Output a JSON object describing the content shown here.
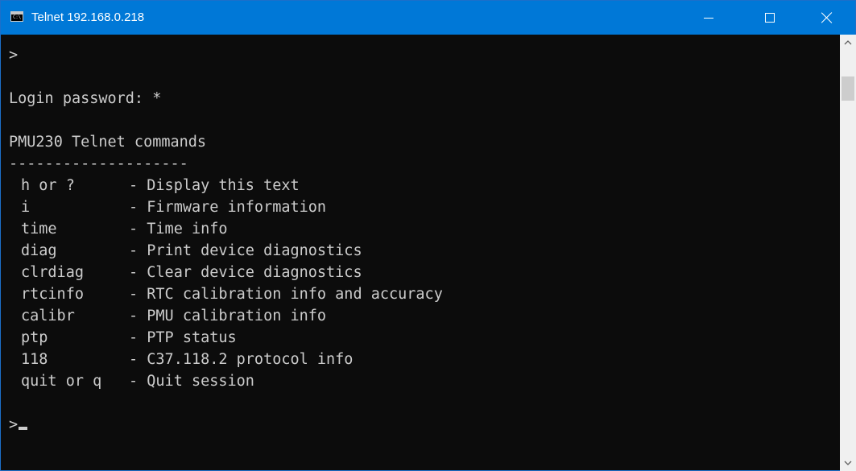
{
  "window": {
    "title": "Telnet 192.168.0.218",
    "icon_label": "C:\\",
    "icon": "console-icon"
  },
  "console": {
    "lines": [
      ">",
      "",
      "Login password: *",
      "",
      "PMU230 Telnet commands",
      "--------------------"
    ],
    "commands": [
      {
        "key": "h or ?",
        "desc": "- Display this text"
      },
      {
        "key": "i",
        "desc": "- Firmware information"
      },
      {
        "key": "time",
        "desc": "- Time info"
      },
      {
        "key": "diag",
        "desc": "- Print device diagnostics"
      },
      {
        "key": "clrdiag",
        "desc": "- Clear device diagnostics"
      },
      {
        "key": "rtcinfo",
        "desc": "- RTC calibration info and accuracy"
      },
      {
        "key": "calibr",
        "desc": "- PMU calibration info"
      },
      {
        "key": "ptp",
        "desc": "- PTP status"
      },
      {
        "key": "118",
        "desc": "- C37.118.2 protocol info"
      },
      {
        "key": "quit or q",
        "desc": "- Quit session"
      }
    ],
    "prompt": ">"
  },
  "colors": {
    "titlebar": "#0078d7",
    "console_bg": "#0c0c0c",
    "console_text": "#cccccc",
    "scrollbar_bg": "#f0f0f0"
  }
}
